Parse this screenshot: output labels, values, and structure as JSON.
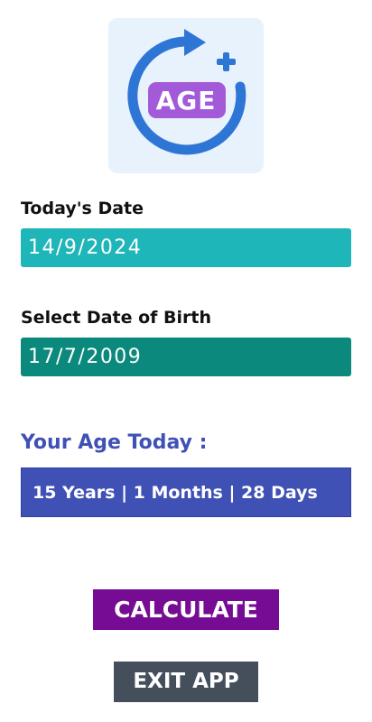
{
  "logo": {
    "text": "AGE",
    "icon": "age-refresh-plus-icon",
    "colors": {
      "tile": "#e8f2fd",
      "ring": "#2e76d6",
      "badge": "#a35ad8",
      "plus": "#2e76d6"
    }
  },
  "today": {
    "label": "Today's Date",
    "value": "14/9/2024",
    "color": "#1eb6b8"
  },
  "dob": {
    "label": "Select Date of Birth",
    "value": "17/7/2009",
    "color": "#0b897c"
  },
  "age": {
    "title": "Your Age Today :",
    "result": "15 Years | 1 Months | 28 Days",
    "color": "#3f51b5"
  },
  "buttons": {
    "calculate": "CALCULATE",
    "exit": "EXIT APP",
    "calculate_color": "#760b94",
    "exit_color": "#454f5c"
  }
}
